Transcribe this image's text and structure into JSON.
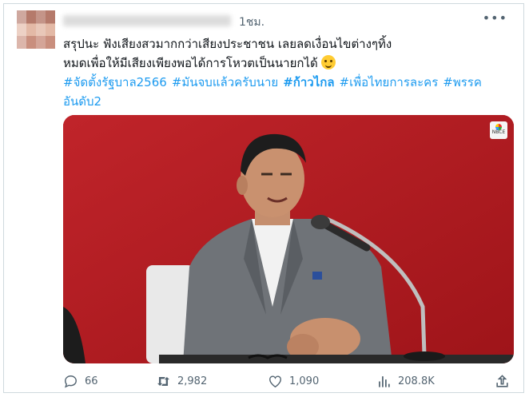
{
  "tweet": {
    "timestamp": "1ชม.",
    "more_icon": "more-horizontal-icon",
    "text_line1": "สรุปนะ ฟังเสียงสวมากกว่าเสียงประชาชน เลยลดเงื่อนไขต่างๆทิ้ง",
    "text_line2": "หมดเพื่อให้มีเสียงเพียงพอได้การโหวตเป็นนายกได้",
    "emoji": "slightly-smiling-face",
    "hashtags": [
      "#จัดตั้งรัฐบาล2566",
      "#มันจบแล้วครับนาย",
      "#ก้าวไกล",
      "#เพื่อไทยการละคร",
      "#พรรค",
      "อันดับ2"
    ]
  },
  "media": {
    "watermark": "NBCE"
  },
  "actions": {
    "replies": "66",
    "retweets": "2,982",
    "likes": "1,090",
    "views": "208.8K"
  },
  "colors": {
    "accent": "#1d9bf0",
    "secondary_text": "#536471",
    "border": "#cfd9de",
    "video_bg": "#b71e24"
  }
}
